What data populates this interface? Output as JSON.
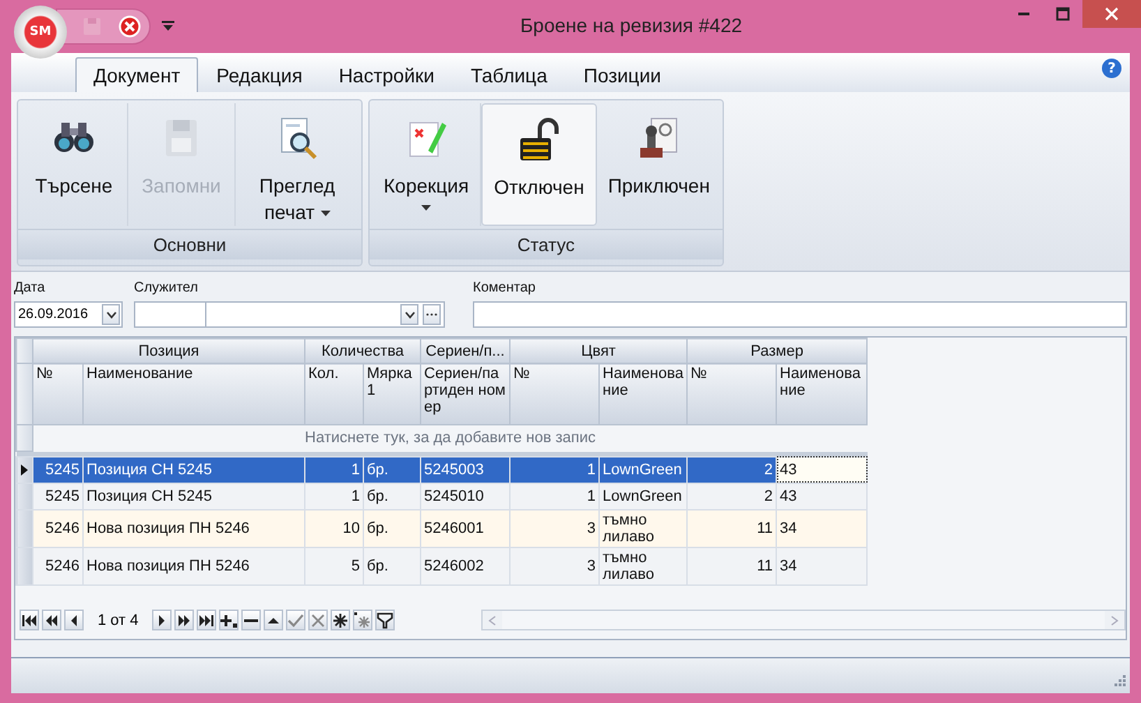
{
  "window": {
    "title": "Броене на ревизия #422",
    "logo": "SM"
  },
  "tabs": [
    {
      "label": "Документ",
      "selected": true
    },
    {
      "label": "Редакция",
      "selected": false
    },
    {
      "label": "Настройки",
      "selected": false
    },
    {
      "label": "Таблица",
      "selected": false
    },
    {
      "label": "Позиции",
      "selected": false
    }
  ],
  "help": "?",
  "ribbon_groups": [
    {
      "label": "Основни",
      "buttons": [
        {
          "label": "Търсене",
          "disabled": false,
          "pressed": false,
          "dropdown": false
        },
        {
          "label": "Запомни",
          "disabled": true,
          "pressed": false,
          "dropdown": false
        },
        {
          "label": "Преглед печат",
          "disabled": false,
          "pressed": false,
          "dropdown": true
        }
      ]
    },
    {
      "label": "Статус",
      "buttons": [
        {
          "label": "Корекция",
          "disabled": false,
          "pressed": false,
          "dropdown": true
        },
        {
          "label": "Отключен",
          "disabled": false,
          "pressed": true,
          "dropdown": false
        },
        {
          "label": "Приключен",
          "disabled": false,
          "pressed": false,
          "dropdown": false
        }
      ]
    }
  ],
  "fields": {
    "date": {
      "label": "Дата",
      "value": "26.09.2016"
    },
    "employee": {
      "label": "Служител"
    },
    "comment": {
      "label": "Коментар"
    }
  },
  "grid": {
    "bands": [
      {
        "label": "Позиция"
      },
      {
        "label": "Количества"
      },
      {
        "label": "Сериен/п..."
      },
      {
        "label": "Цвят"
      },
      {
        "label": "Размер"
      }
    ],
    "columns": [
      {
        "label": "№"
      },
      {
        "label": "Наименование"
      },
      {
        "label": "Кол."
      },
      {
        "label": "Мярка 1"
      },
      {
        "label": "Сериен/партиден номер"
      },
      {
        "label": "№"
      },
      {
        "label": "Наименование"
      },
      {
        "label": "№"
      },
      {
        "label": "Наименование"
      }
    ],
    "new_row_prompt": "Натиснете тук, за да добавите нов запис",
    "rows": [
      {
        "selected": true,
        "cells": [
          "5245",
          "Позиция СН 5245",
          "1",
          "бр.",
          "5245003",
          "1",
          "LownGreen",
          "2",
          "43"
        ]
      },
      {
        "selected": false,
        "cells": [
          "5245",
          "Позиция СН 5245",
          "1",
          "бр.",
          "5245010",
          "1",
          "LownGreen",
          "2",
          "43"
        ]
      },
      {
        "selected": false,
        "cells": [
          "5246",
          "Нова позиция ПН 5246",
          "10",
          "бр.",
          "5246001",
          "3",
          "тъмно лилаво",
          "11",
          "34"
        ]
      },
      {
        "selected": false,
        "cells": [
          "5246",
          "Нова позиция ПН 5246",
          "5",
          "бр.",
          "5246002",
          "3",
          "тъмно лилаво",
          "11",
          "34"
        ]
      }
    ]
  },
  "navigator": {
    "page": "1 от 4"
  }
}
